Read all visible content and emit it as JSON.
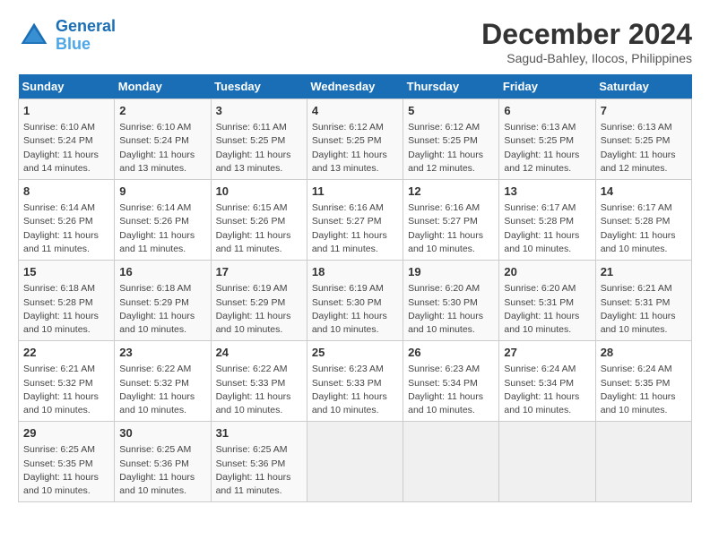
{
  "logo": {
    "name": "General",
    "name2": "Blue"
  },
  "header": {
    "month": "December 2024",
    "location": "Sagud-Bahley, Ilocos, Philippines"
  },
  "weekdays": [
    "Sunday",
    "Monday",
    "Tuesday",
    "Wednesday",
    "Thursday",
    "Friday",
    "Saturday"
  ],
  "weeks": [
    [
      {
        "day": "1",
        "info": "Sunrise: 6:10 AM\nSunset: 5:24 PM\nDaylight: 11 hours\nand 14 minutes."
      },
      {
        "day": "2",
        "info": "Sunrise: 6:10 AM\nSunset: 5:24 PM\nDaylight: 11 hours\nand 13 minutes."
      },
      {
        "day": "3",
        "info": "Sunrise: 6:11 AM\nSunset: 5:25 PM\nDaylight: 11 hours\nand 13 minutes."
      },
      {
        "day": "4",
        "info": "Sunrise: 6:12 AM\nSunset: 5:25 PM\nDaylight: 11 hours\nand 13 minutes."
      },
      {
        "day": "5",
        "info": "Sunrise: 6:12 AM\nSunset: 5:25 PM\nDaylight: 11 hours\nand 12 minutes."
      },
      {
        "day": "6",
        "info": "Sunrise: 6:13 AM\nSunset: 5:25 PM\nDaylight: 11 hours\nand 12 minutes."
      },
      {
        "day": "7",
        "info": "Sunrise: 6:13 AM\nSunset: 5:25 PM\nDaylight: 11 hours\nand 12 minutes."
      }
    ],
    [
      {
        "day": "8",
        "info": "Sunrise: 6:14 AM\nSunset: 5:26 PM\nDaylight: 11 hours\nand 11 minutes."
      },
      {
        "day": "9",
        "info": "Sunrise: 6:14 AM\nSunset: 5:26 PM\nDaylight: 11 hours\nand 11 minutes."
      },
      {
        "day": "10",
        "info": "Sunrise: 6:15 AM\nSunset: 5:26 PM\nDaylight: 11 hours\nand 11 minutes."
      },
      {
        "day": "11",
        "info": "Sunrise: 6:16 AM\nSunset: 5:27 PM\nDaylight: 11 hours\nand 11 minutes."
      },
      {
        "day": "12",
        "info": "Sunrise: 6:16 AM\nSunset: 5:27 PM\nDaylight: 11 hours\nand 10 minutes."
      },
      {
        "day": "13",
        "info": "Sunrise: 6:17 AM\nSunset: 5:28 PM\nDaylight: 11 hours\nand 10 minutes."
      },
      {
        "day": "14",
        "info": "Sunrise: 6:17 AM\nSunset: 5:28 PM\nDaylight: 11 hours\nand 10 minutes."
      }
    ],
    [
      {
        "day": "15",
        "info": "Sunrise: 6:18 AM\nSunset: 5:28 PM\nDaylight: 11 hours\nand 10 minutes."
      },
      {
        "day": "16",
        "info": "Sunrise: 6:18 AM\nSunset: 5:29 PM\nDaylight: 11 hours\nand 10 minutes."
      },
      {
        "day": "17",
        "info": "Sunrise: 6:19 AM\nSunset: 5:29 PM\nDaylight: 11 hours\nand 10 minutes."
      },
      {
        "day": "18",
        "info": "Sunrise: 6:19 AM\nSunset: 5:30 PM\nDaylight: 11 hours\nand 10 minutes."
      },
      {
        "day": "19",
        "info": "Sunrise: 6:20 AM\nSunset: 5:30 PM\nDaylight: 11 hours\nand 10 minutes."
      },
      {
        "day": "20",
        "info": "Sunrise: 6:20 AM\nSunset: 5:31 PM\nDaylight: 11 hours\nand 10 minutes."
      },
      {
        "day": "21",
        "info": "Sunrise: 6:21 AM\nSunset: 5:31 PM\nDaylight: 11 hours\nand 10 minutes."
      }
    ],
    [
      {
        "day": "22",
        "info": "Sunrise: 6:21 AM\nSunset: 5:32 PM\nDaylight: 11 hours\nand 10 minutes."
      },
      {
        "day": "23",
        "info": "Sunrise: 6:22 AM\nSunset: 5:32 PM\nDaylight: 11 hours\nand 10 minutes."
      },
      {
        "day": "24",
        "info": "Sunrise: 6:22 AM\nSunset: 5:33 PM\nDaylight: 11 hours\nand 10 minutes."
      },
      {
        "day": "25",
        "info": "Sunrise: 6:23 AM\nSunset: 5:33 PM\nDaylight: 11 hours\nand 10 minutes."
      },
      {
        "day": "26",
        "info": "Sunrise: 6:23 AM\nSunset: 5:34 PM\nDaylight: 11 hours\nand 10 minutes."
      },
      {
        "day": "27",
        "info": "Sunrise: 6:24 AM\nSunset: 5:34 PM\nDaylight: 11 hours\nand 10 minutes."
      },
      {
        "day": "28",
        "info": "Sunrise: 6:24 AM\nSunset: 5:35 PM\nDaylight: 11 hours\nand 10 minutes."
      }
    ],
    [
      {
        "day": "29",
        "info": "Sunrise: 6:25 AM\nSunset: 5:35 PM\nDaylight: 11 hours\nand 10 minutes."
      },
      {
        "day": "30",
        "info": "Sunrise: 6:25 AM\nSunset: 5:36 PM\nDaylight: 11 hours\nand 10 minutes."
      },
      {
        "day": "31",
        "info": "Sunrise: 6:25 AM\nSunset: 5:36 PM\nDaylight: 11 hours\nand 11 minutes."
      },
      {
        "day": "",
        "info": ""
      },
      {
        "day": "",
        "info": ""
      },
      {
        "day": "",
        "info": ""
      },
      {
        "day": "",
        "info": ""
      }
    ]
  ]
}
